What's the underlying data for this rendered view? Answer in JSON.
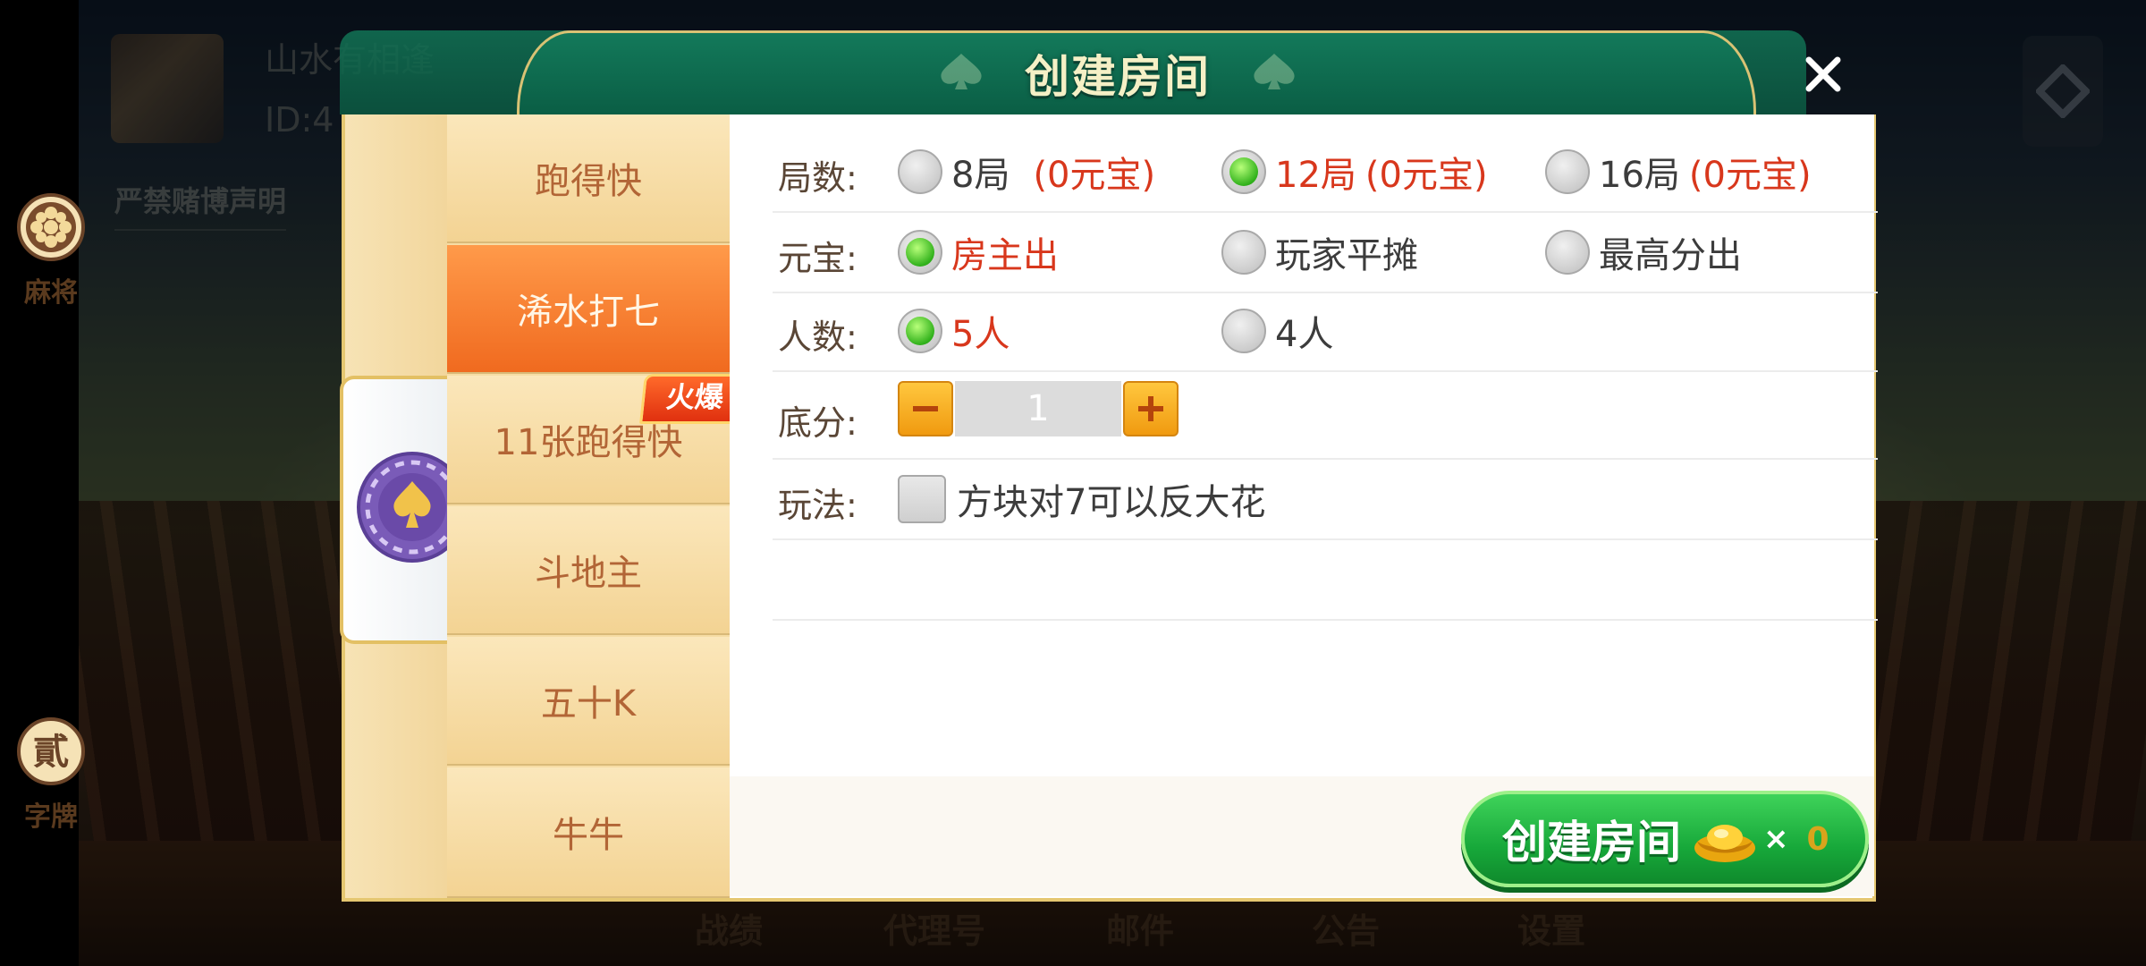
{
  "background": {
    "player_name": "山水有相逢",
    "player_id": "ID:4",
    "notice": "严禁赌博声明",
    "bottom_nav": [
      "战绩",
      "代理号",
      "邮件",
      "公告",
      "设置"
    ]
  },
  "dialog": {
    "title": "创建房间",
    "close_icon": "close-icon",
    "categories": [
      {
        "label": "麻将",
        "icon": "flower-icon",
        "active": false
      },
      {
        "label": "",
        "icon": "spade-chip-icon",
        "active": true
      },
      {
        "label": "字牌",
        "icon": "er-chip-icon",
        "glyph": "貳",
        "active": false
      }
    ],
    "games": [
      {
        "label": "跑得快",
        "selected": false
      },
      {
        "label": "浠水打七",
        "selected": true
      },
      {
        "label": "11张跑得快",
        "selected": false,
        "badge": "火爆"
      },
      {
        "label": "斗地主",
        "selected": false
      },
      {
        "label": "五十K",
        "selected": false
      },
      {
        "label": "牛牛",
        "selected": false
      }
    ],
    "options": {
      "rounds": {
        "label": "局数:",
        "choices": [
          {
            "label": "8局",
            "cost": "(0元宝)",
            "selected": false
          },
          {
            "label": "12局",
            "cost": "(0元宝)",
            "selected": true
          },
          {
            "label": "16局",
            "cost": "(0元宝)",
            "selected": false
          }
        ]
      },
      "payment": {
        "label": "元宝:",
        "choices": [
          {
            "label": "房主出",
            "selected": true
          },
          {
            "label": "玩家平摊",
            "selected": false
          },
          {
            "label": "最高分出",
            "selected": false
          }
        ]
      },
      "players": {
        "label": "人数:",
        "choices": [
          {
            "label": "5人",
            "selected": true
          },
          {
            "label": "4人",
            "selected": false
          }
        ]
      },
      "base_score": {
        "label": "底分:",
        "value": "1"
      },
      "rules": {
        "label": "玩法:",
        "checkbox_label": "方块对7可以反大花",
        "checked": false
      }
    },
    "create_button": {
      "label": "创建房间",
      "icon": "gold-ingot-icon",
      "times": "×",
      "count": "0"
    }
  },
  "colors": {
    "header_green": "#0a5d44",
    "accent_orange": "#f06a1f",
    "selected_red": "#d8371c",
    "radio_green": "#32b21c",
    "button_green": "#17a83a"
  }
}
